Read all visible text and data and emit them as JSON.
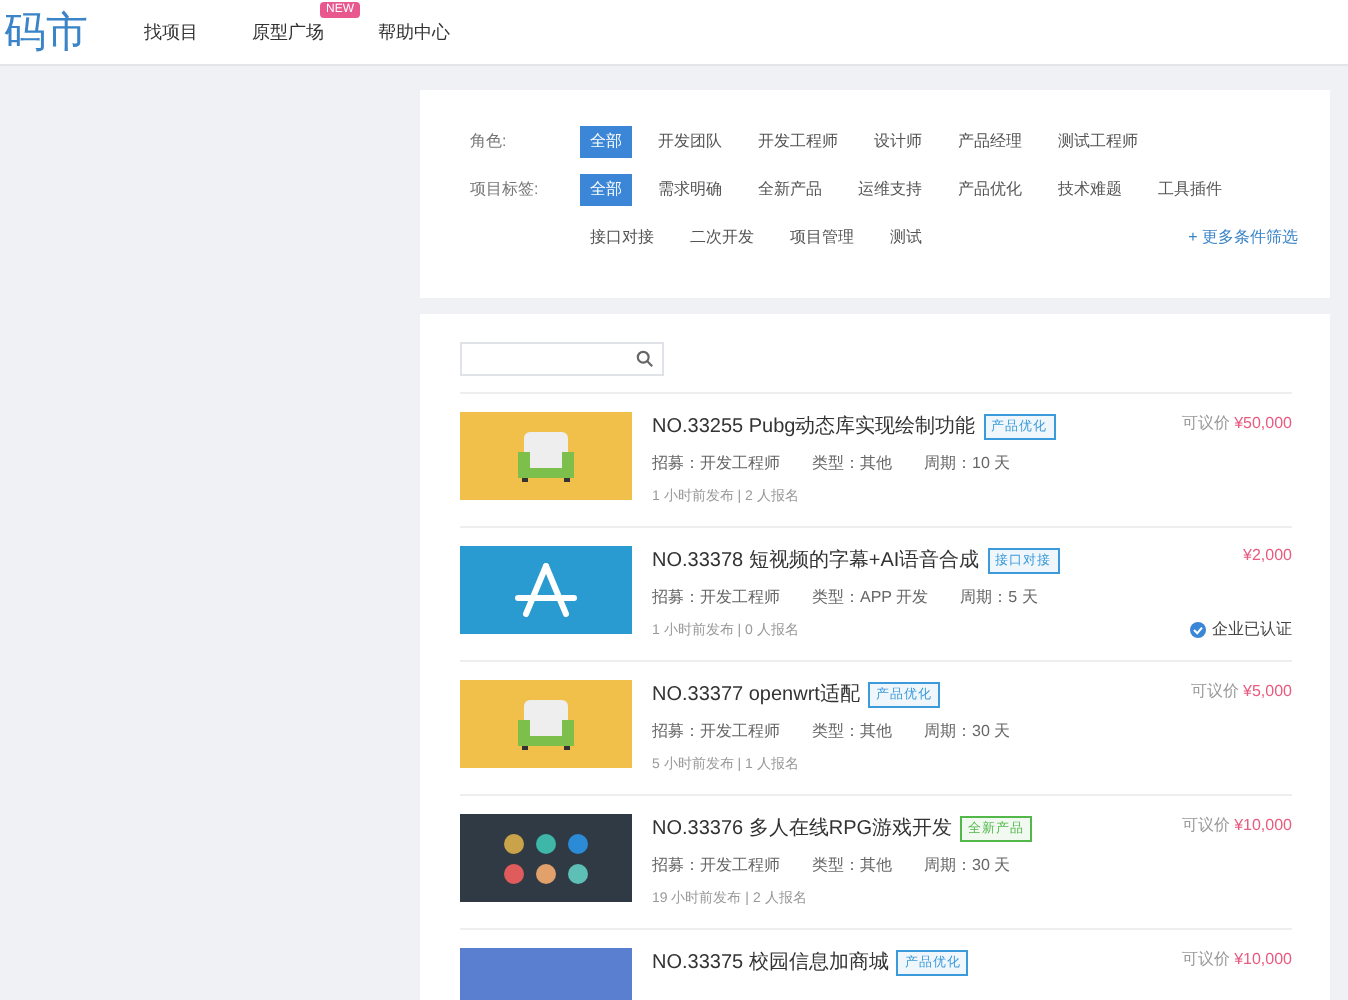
{
  "header": {
    "logo": "码市",
    "nav": [
      {
        "label": "找项目"
      },
      {
        "label": "原型广场",
        "badge": "NEW"
      },
      {
        "label": "帮助中心"
      }
    ]
  },
  "filters": {
    "rows": [
      {
        "label": "角色:",
        "options": [
          {
            "label": "全部",
            "selected": true
          },
          {
            "label": "开发团队",
            "selected": false
          },
          {
            "label": "开发工程师",
            "selected": false
          },
          {
            "label": "设计师",
            "selected": false
          },
          {
            "label": "产品经理",
            "selected": false
          },
          {
            "label": "测试工程师",
            "selected": false
          }
        ]
      },
      {
        "label": "项目标签:",
        "options": [
          {
            "label": "全部",
            "selected": true
          },
          {
            "label": "需求明确",
            "selected": false
          },
          {
            "label": "全新产品",
            "selected": false
          },
          {
            "label": "运维支持",
            "selected": false
          },
          {
            "label": "产品优化",
            "selected": false
          },
          {
            "label": "技术难题",
            "selected": false
          },
          {
            "label": "工具插件",
            "selected": false
          },
          {
            "label": "接口对接",
            "selected": false
          },
          {
            "label": "二次开发",
            "selected": false
          },
          {
            "label": "项目管理",
            "selected": false
          },
          {
            "label": "测试",
            "selected": false
          }
        ]
      }
    ],
    "more": "+ 更多条件筛选"
  },
  "projects": [
    {
      "kind": "sofa",
      "title": "NO.33255 Pubg动态库实现绘制功能",
      "tag": "产品优化",
      "color": "#3b9ad9",
      "recruit": "招募：开发工程师",
      "type": "类型：其他",
      "period": "周期：10 天",
      "meta": "1 小时前发布 | 2 人报名",
      "price_label": "可议价",
      "price": "¥50,000"
    },
    {
      "kind": "appstore",
      "title": "NO.33378 短视频的字幕+AI语音合成",
      "tag": "接口对接",
      "color": "#3b9ad9",
      "recruit": "招募：开发工程师",
      "type": "类型：APP 开发",
      "period": "周期：5 天",
      "meta": "1 小时前发布 | 0 人报名",
      "price": "¥2,000",
      "verified": "企业已认证"
    },
    {
      "kind": "sofa",
      "title": "NO.33377 openwrt适配",
      "tag": "产品优化",
      "color": "#3b9ad9",
      "recruit": "招募：开发工程师",
      "type": "类型：其他",
      "period": "周期：30 天",
      "meta": "5 小时前发布 | 1 人报名",
      "price_label": "可议价",
      "price": "¥5,000"
    },
    {
      "kind": "apps",
      "title": "NO.33376 多人在线RPG游戏开发",
      "tag": "全新产品",
      "color": "#52b84a",
      "recruit": "招募：开发工程师",
      "type": "类型：其他",
      "period": "周期：30 天",
      "meta": "19 小时前发布 | 2 人报名",
      "price_label": "可议价",
      "price": "¥10,000"
    },
    {
      "kind": "banner",
      "title": "NO.33375 校园信息加商城",
      "tag": "产品优化",
      "color": "#3b9ad9",
      "price_label": "可议价",
      "price": "¥10,000"
    }
  ]
}
